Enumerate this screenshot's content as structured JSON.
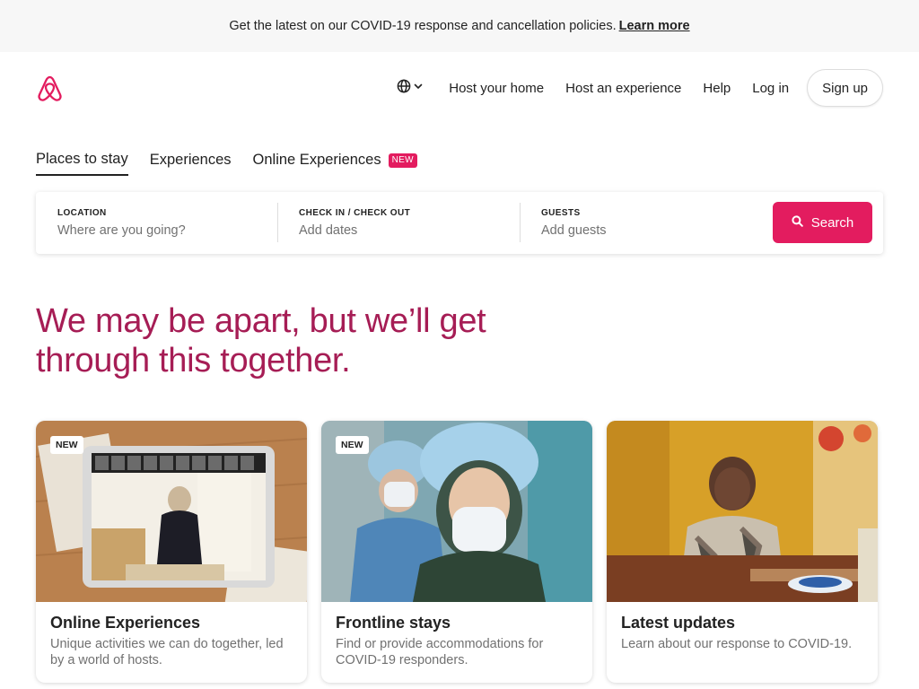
{
  "banner": {
    "text": "Get the latest on our COVID-19 response and cancellation policies.",
    "link": "Learn more"
  },
  "header": {
    "logo_icon": "airbnb-logo-icon",
    "language_icon": "globe-icon",
    "nav": {
      "host_home": "Host your home",
      "host_experience": "Host an experience",
      "help": "Help",
      "login": "Log in",
      "signup": "Sign up"
    }
  },
  "tabs": [
    {
      "label": "Places to stay",
      "active": true
    },
    {
      "label": "Experiences",
      "active": false
    },
    {
      "label": "Online Experiences",
      "active": false,
      "badge": "NEW"
    }
  ],
  "search": {
    "location": {
      "label": "Location",
      "placeholder": "Where are you going?"
    },
    "dates": {
      "label": "Check in / Check out",
      "placeholder": "Add dates"
    },
    "guests": {
      "label": "Guests",
      "placeholder": "Add guests"
    },
    "button": "Search",
    "button_icon": "search-icon"
  },
  "headline": "We may be apart, but we’ll get through this together.",
  "cards": [
    {
      "badge": "NEW",
      "title": "Online Experiences",
      "description": "Unique activities we can do together, led by a world of hosts."
    },
    {
      "badge": "NEW",
      "title": "Frontline stays",
      "description": "Find or provide accommodations for COVID-19 responders."
    },
    {
      "title": "Latest updates",
      "description": "Learn about our response to COVID-19."
    }
  ],
  "colors": {
    "brand": "#e31c5f",
    "headline": "#a61d55",
    "text": "#222222",
    "muted": "#717171",
    "banner_bg": "#f7f7f7"
  }
}
